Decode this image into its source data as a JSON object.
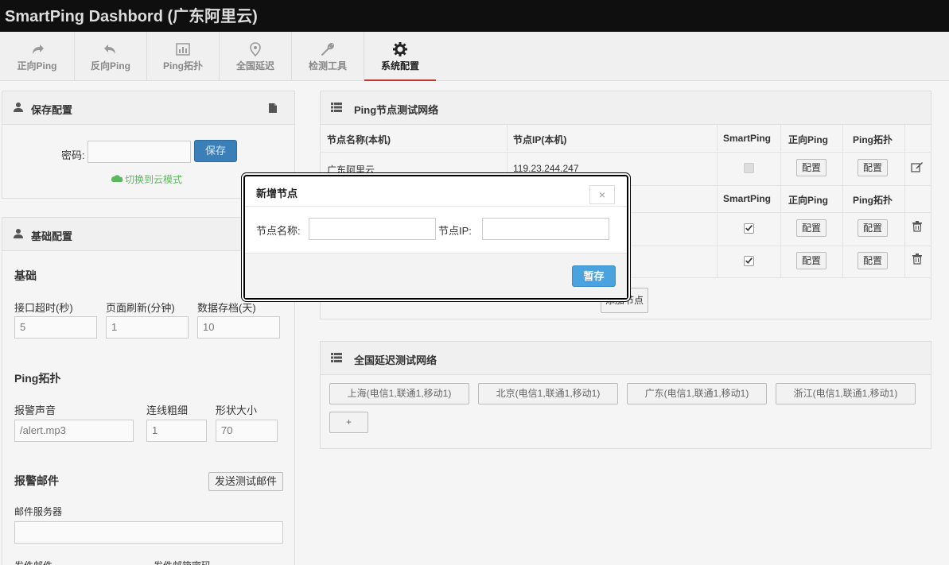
{
  "app": {
    "title": "SmartPing Dashbord (广东阿里云)"
  },
  "nav": {
    "tabs": [
      {
        "label": "正向Ping",
        "icon": "share-icon"
      },
      {
        "label": "反向Ping",
        "icon": "reply-icon"
      },
      {
        "label": "Ping拓扑",
        "icon": "chart-icon"
      },
      {
        "label": "全国延迟",
        "icon": "map-marker-icon"
      },
      {
        "label": "检测工具",
        "icon": "wrench-icon"
      },
      {
        "label": "系统配置",
        "icon": "gear-icon",
        "active": true
      }
    ]
  },
  "save_panel": {
    "title": "保存配置",
    "password_label": "密码:",
    "password_value": "",
    "save_label": "保存",
    "cloud_label": "切换到云模式"
  },
  "basic_panel": {
    "title": "基础配置",
    "basic": {
      "heading": "基础",
      "timeout_label": "接口超时(秒)",
      "timeout_value": "5",
      "refresh_label": "页面刷新(分钟)",
      "refresh_value": "1",
      "archive_label": "数据存档(天)",
      "archive_value": "10"
    },
    "topology": {
      "heading": "Ping拓扑",
      "sound_label": "报警声音",
      "sound_value": "/alert.mp3",
      "line_label": "连线粗细",
      "line_value": "1",
      "shape_label": "形状大小",
      "shape_value": "70"
    },
    "mail": {
      "heading": "报警邮件",
      "test_label": "发送测试邮件",
      "server_label": "邮件服务器",
      "server_value": "",
      "from_label": "发件邮件",
      "pass_label": "发件邮箱密码"
    }
  },
  "ping_panel": {
    "title": "Ping节点测试网络",
    "headers": [
      "节点名称(本机)",
      "节点IP(本机)",
      "SmartPing",
      "正向Ping",
      "Ping拓扑"
    ],
    "local_row": {
      "name": "广东阿里云",
      "ip": "119.23.244.247",
      "config": "配置"
    },
    "sub_headers": [
      "SmartPing",
      "正向Ping",
      "Ping拓扑"
    ],
    "config_label": "配置",
    "add_node_label": "添加节点"
  },
  "china_panel": {
    "title": "全国延迟测试网络",
    "tags": [
      "上海(电信1,联通1,移动1)",
      "北京(电信1,联通1,移动1)",
      "广东(电信1,联通1,移动1)",
      "浙江(电信1,联通1,移动1)"
    ],
    "add_label": "+"
  },
  "modal": {
    "title": "新增节点",
    "close": "×",
    "name_label": "节点名称:",
    "name_value": "",
    "ip_label": "节点IP:",
    "ip_value": "",
    "save_label": "暂存"
  },
  "colors": {
    "accent": "#4aa3df",
    "active_tab": "#c0392b",
    "cloud": "#5cb85c"
  }
}
